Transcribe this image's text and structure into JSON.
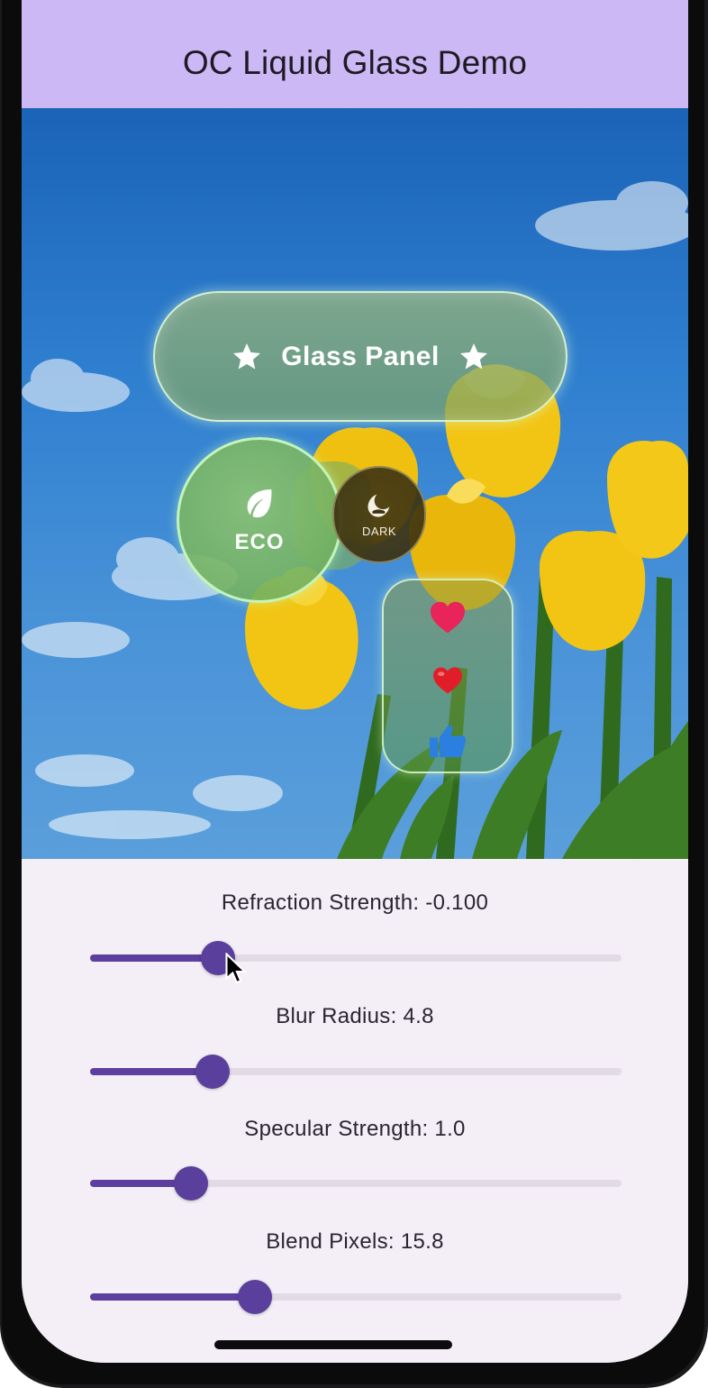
{
  "app": {
    "title": "OC Liquid Glass Demo"
  },
  "scene": {
    "glass_panel": {
      "label": "Glass Panel",
      "icons": [
        "star-icon",
        "star-icon"
      ]
    },
    "eco_button": {
      "label": "ECO",
      "icon": "leaf-icon"
    },
    "dark_button": {
      "label": "DARK",
      "icon": "dark-mode-icon"
    },
    "reaction_stack": {
      "icons": [
        "heart-icon",
        "heart-emoji-icon",
        "thumbs-up-icon"
      ]
    }
  },
  "controls": {
    "refraction": {
      "label": "Refraction Strength: -0.100",
      "fraction": 0.24
    },
    "blur": {
      "label": "Blur Radius: 4.8",
      "fraction": 0.23
    },
    "specular": {
      "label": "Specular Strength: 1.0",
      "fraction": 0.19
    },
    "blend": {
      "label": "Blend Pixels: 15.8",
      "fraction": 0.31
    }
  },
  "colors": {
    "app_bar": "#cbb8f5",
    "slider_accent": "#5c3f9e",
    "slider_track": "#e2dbe6",
    "heart": "#e8245a",
    "thumbs_up": "#2a7fe0"
  }
}
